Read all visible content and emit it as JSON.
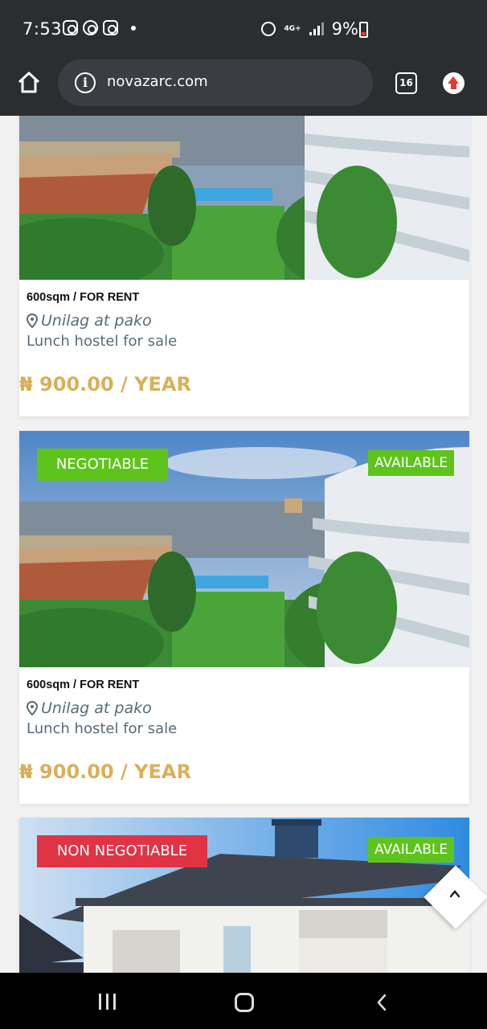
{
  "status_bar": {
    "time": "7:53",
    "network": "4G+",
    "battery": "9%"
  },
  "browser": {
    "url": "novazarc.com",
    "tab_count": "16"
  },
  "listings": [
    {
      "size_type": "600sqm / FOR RENT",
      "location": "Unilag at pako",
      "description": "Lunch hostel for sale",
      "price": "₦ 900.00 / YEAR"
    },
    {
      "badge": "NEGOTIABLE",
      "status": "AVAILABLE",
      "size_type": "600sqm / FOR RENT",
      "location": "Unilag at pako",
      "description": "Lunch hostel for sale",
      "price": "₦ 900.00 / YEAR"
    },
    {
      "badge": "NON NEGOTIABLE",
      "status": "AVAILABLE"
    }
  ],
  "colors": {
    "badge_green": "#5ec41c",
    "badge_red": "#e03344",
    "price": "#d9b05a",
    "toolbar": "#2b2e31"
  },
  "icons": [
    "home-icon",
    "info-icon",
    "tabs-icon",
    "update-icon",
    "location-pin-icon",
    "chevron-up-icon",
    "recent-apps-icon",
    "home-nav-icon",
    "back-icon"
  ]
}
